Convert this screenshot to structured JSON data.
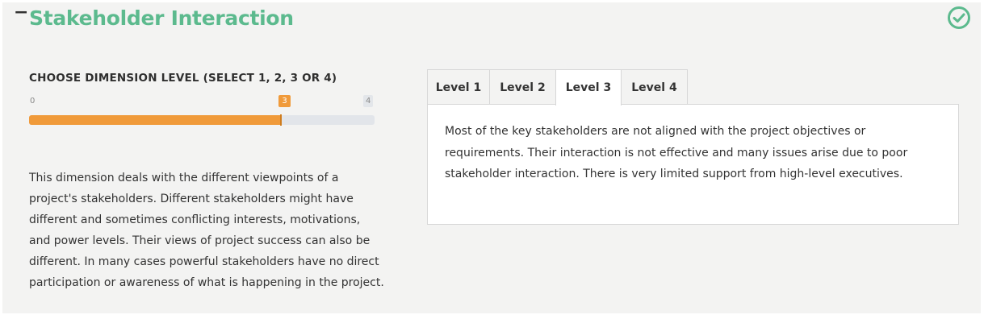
{
  "section": {
    "toggle_symbol": "−",
    "title": "Stakeholder Interaction",
    "status_icon": "check-circle-icon",
    "status_color": "#5cba8e"
  },
  "dimension": {
    "label": "CHOOSE DIMENSION LEVEL (SELECT 1, 2, 3 OR 4)",
    "min": "0",
    "max": "4",
    "value": "3",
    "fraction": 0.75,
    "accent_color": "#f09a3a"
  },
  "description": "This dimension deals with the different viewpoints of a project's stakeholders. Different stakeholders might have different and sometimes conflicting interests, motivations, and power levels. Their views of project success can also be different. In many cases powerful stakeholders have no direct participation or awareness of what is happening in the project.",
  "tabs": [
    {
      "label": "Level 1",
      "active": false
    },
    {
      "label": "Level 2",
      "active": false
    },
    {
      "label": "Level 3",
      "active": true
    },
    {
      "label": "Level 4",
      "active": false
    }
  ],
  "active_tab_text": "Most of the key stakeholders are not aligned with the project objectives or requirements. Their interaction is not effective and many issues arise due to poor stakeholder interaction. There is very limited support from high-level executives."
}
